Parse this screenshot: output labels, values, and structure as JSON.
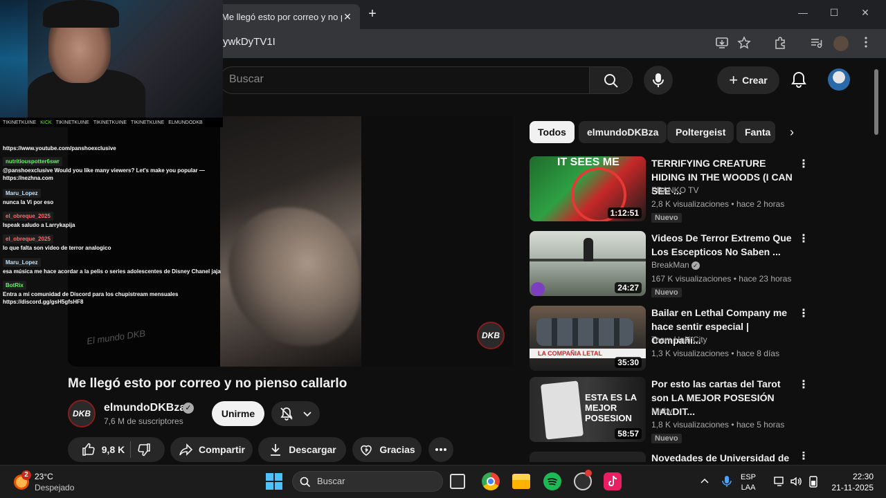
{
  "browser": {
    "tab_title": "Me llegó esto por correo y no pienso callarlo",
    "tab_close": "✕",
    "new_tab": "+",
    "url": "ywkDyTV1I",
    "win_min": "—",
    "win_max": "☐",
    "win_close": "✕"
  },
  "youtube": {
    "search_placeholder": "Buscar",
    "create_label": "Crear",
    "chips": [
      "Todos",
      "elmundoDKBza",
      "Poltergeist",
      "Fanta"
    ],
    "video": {
      "title": "Me llegó esto por correo y no pienso callarlo",
      "channel": "elmundoDKBza",
      "channel_avatar_text": "DKB",
      "subscribers": "7,6 M de suscriptores",
      "join_label": "Unirme",
      "likes": "9,8 K",
      "share_label": "Compartir",
      "download_label": "Descargar",
      "thanks_label": "Gracias",
      "watermark": "DKB",
      "watermark_logo": "El mundo DKB"
    },
    "recommendations": [
      {
        "title": "TERRIFYING CREATURE HIDING IN THE WOODS (I CAN SEE ...",
        "channel": "FRANKO TV",
        "verified": false,
        "views": "2,8 K visualizaciones",
        "age": "hace 2 horas",
        "badge": "Nuevo",
        "duration": "1:12:51",
        "thumb_text": "IT SEES ME"
      },
      {
        "title": "Videos De Terror Extremo Que Los Escepticos No Saben ...",
        "channel": "BreakMan",
        "verified": true,
        "views": "167 K visualizaciones",
        "age": "hace 23 horas",
        "badge": "Nuevo",
        "duration": "24:27",
        "thumb_text": ""
      },
      {
        "title": "Bailar en Lethal Company me hace sentir especial | Compañí...",
        "channel": "Team Haiti City",
        "verified": false,
        "views": "1,3 K visualizaciones",
        "age": "hace 8 días",
        "badge": "",
        "duration": "35:30",
        "thumb_text": "LA COMPAÑIA LETAL"
      },
      {
        "title": "Por esto las cartas del Tarot son LA MEJOR POSESIÓN MALDIT...",
        "channel": "Niuby",
        "verified": false,
        "views": "1,8 K visualizaciones",
        "age": "hace 5 horas",
        "badge": "Nuevo",
        "duration": "58:57",
        "thumb_text": "ESTA ES LA MEJOR POSESION"
      },
      {
        "title": "Novedades de Universidad de",
        "channel": "",
        "verified": false,
        "views": "",
        "age": "",
        "badge": "",
        "duration": "",
        "thumb_text": ""
      }
    ]
  },
  "overlay": {
    "social": [
      "TIKINETKUINE",
      "KICK",
      "TIKINETKUINE",
      "TIKINETKUINE",
      "TIKINETKUINE",
      "ELMUNDODKB"
    ],
    "chat": [
      {
        "user": "",
        "text": "https://www.youtube.com/panshoexclusive",
        "color": "blue"
      },
      {
        "user": "nutritiouspotter6swr",
        "text": "@panshoexclusive Would you like many viewers? Let's make you popular — https://nezhna.com",
        "color": "green"
      },
      {
        "user": "Maru_Lopez",
        "text": "nunca la Vi por eso",
        "color": "blue"
      },
      {
        "user": "el_obreque_2025",
        "text": "Ispeak saludo a Larrykapija",
        "color": "red"
      },
      {
        "user": "el_obreque_2025",
        "text": "lo que falta son video de terror analogico",
        "color": "red"
      },
      {
        "user": "Maru_Lopez",
        "text": "esa música me hace acordar a la pelis o series adolescentes de Disney Chanel jaja",
        "color": "blue"
      },
      {
        "user": "BotRix",
        "text": "Entra a mi comunidad de Discord para los chupistream mensuales https://discord.gg/gsH5gfsHF8",
        "color": "green"
      }
    ]
  },
  "taskbar": {
    "weather_temp": "23°C",
    "weather_cond": "Despejado",
    "weather_badge": "2",
    "search_placeholder": "Buscar",
    "lang_1": "ESP",
    "lang_2": "LAA",
    "time": "22:30",
    "date": "21-11-2025"
  }
}
